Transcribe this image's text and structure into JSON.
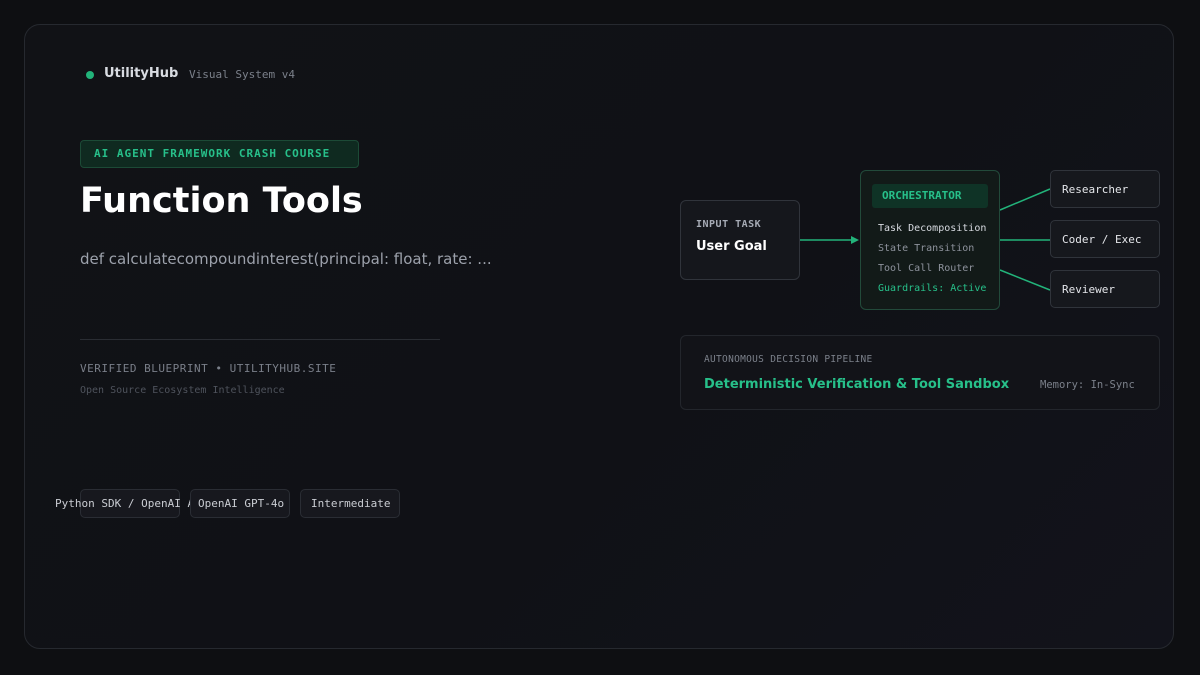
{
  "brand": {
    "name": "UtilityHub",
    "subtitle": "Visual System v4",
    "accent": "#22b37a"
  },
  "hero": {
    "badge": "AI AGENT FRAMEWORK CRASH COURSE",
    "title": "Function Tools",
    "code": "def calculatecompoundinterest(principal: float, rate: ...",
    "verified": "VERIFIED BLUEPRINT • UTILITYHUB.SITE",
    "tagline": "Open Source Ecosystem Intelligence"
  },
  "chips": [
    "Python SDK / OpenAI Agents",
    "OpenAI GPT-4o",
    "Intermediate"
  ],
  "diagram": {
    "input": {
      "label": "INPUT TASK",
      "value": "User Goal"
    },
    "orchestrator": {
      "title": "ORCHESTRATOR",
      "items": [
        "Task Decomposition",
        "State Transition",
        "Tool Call Router",
        "Guardrails: Active"
      ]
    },
    "agents": [
      "Researcher",
      "Coder / Exec",
      "Reviewer"
    ],
    "pipeline": {
      "label": "AUTONOMOUS DECISION PIPELINE",
      "title": "Deterministic Verification & Tool Sandbox",
      "memory": "Memory: In-Sync"
    }
  }
}
